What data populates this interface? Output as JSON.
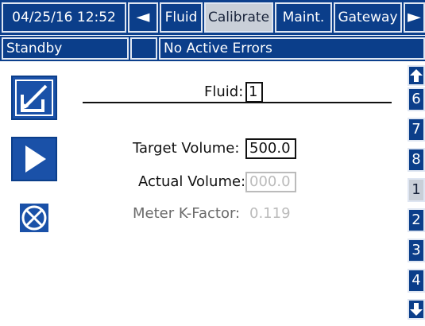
{
  "header": {
    "datetime": "04/25/16 12:52",
    "back_arrow": "⇦",
    "tabs": [
      {
        "label": "Fluid"
      },
      {
        "label": "Calibrate"
      },
      {
        "label": "Maint."
      },
      {
        "label": "Gateway"
      }
    ],
    "forward_arrow": "⇨",
    "active_tab": "Calibrate"
  },
  "status": {
    "mode": "Standby",
    "message": "No Active Errors"
  },
  "side_buttons": [
    {
      "icon": "edit-icon"
    },
    {
      "icon": "play-icon"
    },
    {
      "icon": "cancel-icon"
    }
  ],
  "form": {
    "fluid_label": "Fluid:",
    "fluid_value": "1",
    "target_volume_label": "Target Volume:",
    "target_volume_value": "500.0",
    "actual_volume_label": "Actual Volume:",
    "actual_volume_value": "000.0",
    "k_factor_label": "Meter K-Factor:",
    "k_factor_value": "0.119"
  },
  "rail": {
    "up_icon": "arrow-up-icon",
    "items": [
      "6",
      "7",
      "8",
      "1",
      "2",
      "3",
      "4"
    ],
    "selected": "1",
    "down_icon": "arrow-down-icon"
  },
  "colors": {
    "accent_blue": "#0b3e8a",
    "button_blue": "#1a51a8",
    "selected_gray": "#c9cfd8"
  }
}
